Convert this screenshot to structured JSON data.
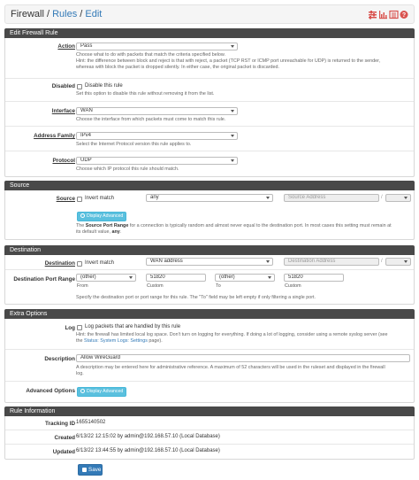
{
  "breadcrumb": {
    "root": "Firewall",
    "sep1": "/",
    "level1": "Rules",
    "sep2": "/",
    "level2": "Edit"
  },
  "sections": {
    "edit": "Edit Firewall Rule",
    "source": "Source",
    "destination": "Destination",
    "extra": "Extra Options",
    "info": "Rule Information"
  },
  "action": {
    "label": "Action",
    "value": "Pass",
    "help1": "Choose what to do with packets that match the criteria specified below.",
    "help2": "Hint: the difference between block and reject is that with reject, a packet (TCP RST or ICMP port unreachable for UDP) is returned to the sender,",
    "help3": "whereas with block the packet is dropped silently. In either case, the original packet is discarded."
  },
  "disabled": {
    "label": "Disabled",
    "checkbox": "Disable this rule",
    "help": "Set this option to disable this rule without removing it from the list."
  },
  "interface": {
    "label": "Interface",
    "value": "WAN",
    "help": "Choose the interface from which packets must come to match this rule."
  },
  "family": {
    "label": "Address Family",
    "value": "IPv4",
    "help": "Select the Internet Protocol version this rule applies to."
  },
  "protocol": {
    "label": "Protocol",
    "value": "UDP",
    "help": "Choose which IP protocol this rule should match."
  },
  "source": {
    "label": "Source",
    "invert": "Invert match",
    "type": "any",
    "addr_placeholder": "Source Address",
    "slash": "/",
    "adv_button": "Display Advanced",
    "help_pre": "The ",
    "help_bold": "Source Port Range",
    "help_mid": " for a connection is typically random and almost never equal to the destination port. In most cases this setting must remain at",
    "help_line2_pre": "its default value, ",
    "help_line2_bold": "any",
    "help_line2_post": "."
  },
  "destination": {
    "label": "Destination",
    "invert": "Invert match",
    "type": "WAN address",
    "addr_placeholder": "Destination Address",
    "slash": "/",
    "port_label": "Destination Port Range",
    "from_sel": "(other)",
    "from_val": "51820",
    "to_sel": "(other)",
    "to_val": "51820",
    "from": "From",
    "custom1": "Custom",
    "to": "To",
    "custom2": "Custom",
    "help": "Specify the destination port or port range for this rule. The \"To\" field may be left empty if only filtering a single port."
  },
  "log": {
    "label": "Log",
    "checkbox": "Log packets that are handled by this rule",
    "help1": "Hint: the firewall has limited local log space. Don't turn on logging for everything. If doing a lot of logging, consider using a remote syslog server (see",
    "help2_pre": "the ",
    "help2_link": "Status: System Logs: Settings",
    "help2_post": " page)."
  },
  "description": {
    "label": "Description",
    "value": "Allow WireGuard",
    "help1": "A description may be entered here for administrative reference. A maximum of 52 characters will be used in the ruleset and displayed in the firewall",
    "help2": "log."
  },
  "advanced": {
    "label": "Advanced Options",
    "button": "Display Advanced"
  },
  "info": {
    "tracking_label": "Tracking ID",
    "tracking": "1655140502",
    "created_label": "Created",
    "created": "6/13/22 12:15:02 by admin@192.168.57.10 (Local Database)",
    "updated_label": "Updated",
    "updated": "6/13/22 13:44:55 by admin@192.168.57.10 (Local Database)"
  },
  "save": "Save",
  "colors": {
    "header": "#494949",
    "link": "#337ab7",
    "info_button": "#5bc0de",
    "save": "#337ab7",
    "icons": "#d9534f"
  },
  "icons": [
    "sliders-icon",
    "chart-icon",
    "list-icon",
    "help-icon"
  ]
}
